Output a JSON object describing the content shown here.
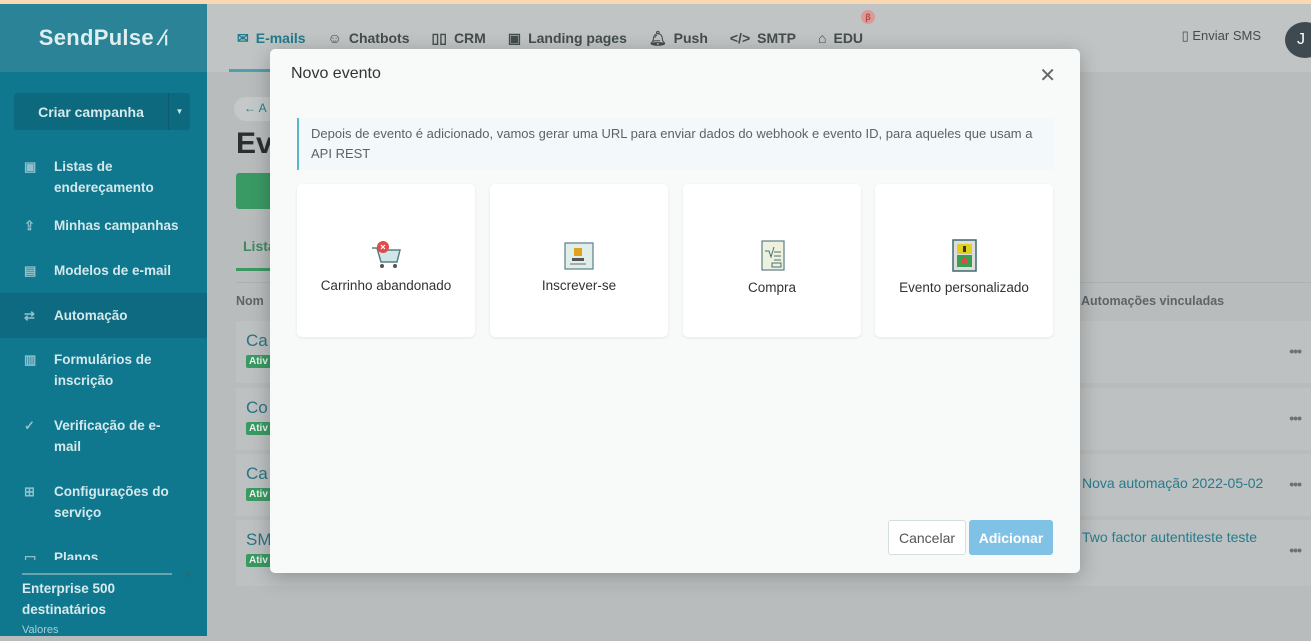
{
  "app": {
    "logo": "SendPulse"
  },
  "sidebar": {
    "create_label": "Criar campanha",
    "items": [
      {
        "label": "Listas de endereçamento",
        "icon": "address-book-icon"
      },
      {
        "label": "Minhas campanhas",
        "icon": "upload-icon"
      },
      {
        "label": "Modelos de e-mail",
        "icon": "template-icon"
      },
      {
        "label": "Automação",
        "icon": "automation-icon",
        "active": true
      },
      {
        "label": "Formulários de inscrição",
        "icon": "form-icon"
      },
      {
        "label": "Verificação de e-mail",
        "icon": "check-circle-icon"
      },
      {
        "label": "Configurações do serviço",
        "icon": "settings-icon"
      },
      {
        "label": "Planos",
        "icon": "plans-icon"
      }
    ],
    "plan": "Enterprise 500 destinatários",
    "plan_sub": "Valores"
  },
  "header": {
    "tabs": [
      {
        "label": "E-mails",
        "icon": "mail-icon",
        "active": true
      },
      {
        "label": "Chatbots",
        "icon": "chatbot-icon"
      },
      {
        "label": "CRM",
        "icon": "crm-icon"
      },
      {
        "label": "Landing pages",
        "icon": "landing-icon"
      },
      {
        "label": "Push",
        "icon": "bell-icon"
      },
      {
        "label": "SMTP",
        "icon": "code-icon"
      },
      {
        "label": "EDU",
        "icon": "graduation-cap-icon",
        "badge": "β"
      }
    ],
    "sms": "Enviar SMS",
    "avatar": "J"
  },
  "page": {
    "back": "← A",
    "title": "Ev",
    "subtab": "Lista",
    "col_name": "Nom",
    "col_auto": "Automações vinculadas",
    "rows": [
      {
        "name": "Ca",
        "status": "Ativ",
        "auto": ""
      },
      {
        "name": "Co",
        "status": "Ativ",
        "auto": ""
      },
      {
        "name": "Ca",
        "status": "Ativ",
        "auto": "Nova automação 2022-05-02"
      },
      {
        "name": "SM",
        "status": "Ativ",
        "auto": "Two factor autentiteste teste"
      }
    ]
  },
  "modal": {
    "title": "Novo evento",
    "info": "Depois de evento é adicionado, vamos gerar uma URL para enviar dados do webhook e evento ID, para aqueles que usam a API REST",
    "cards": [
      {
        "label": "Carrinho abandonado",
        "icon": "abandoned-cart-icon"
      },
      {
        "label": "Inscrever-se",
        "icon": "subscribe-icon"
      },
      {
        "label": "Compra",
        "icon": "receipt-icon"
      },
      {
        "label": "Evento personalizado",
        "icon": "custom-event-icon"
      }
    ],
    "cancel": "Cancelar",
    "add": "Adicionar"
  },
  "colors": {
    "sidebar": "#0f788e",
    "accent": "#1f7b8c",
    "primary_disabled": "#80c2e5",
    "success": "#3a9a63"
  }
}
